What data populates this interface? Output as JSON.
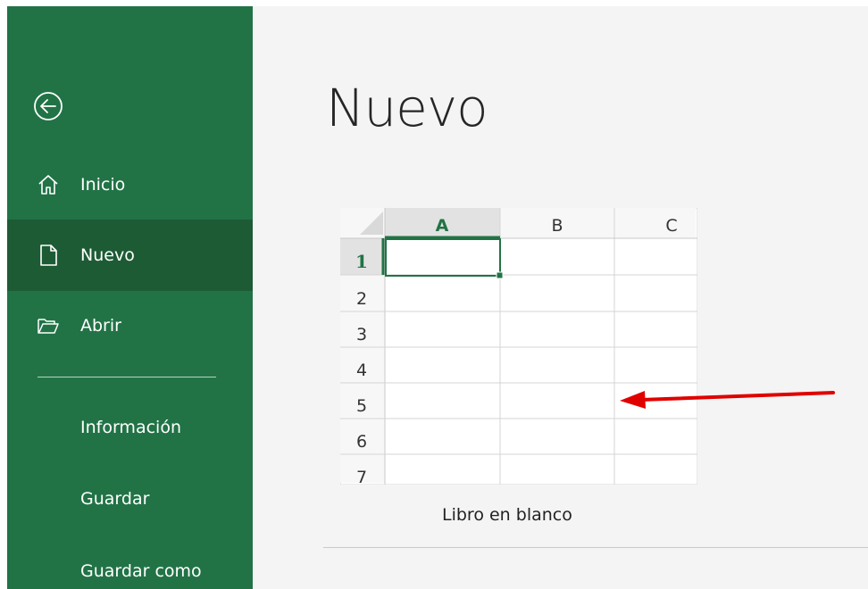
{
  "sidebar": {
    "back_icon": "back-arrow-icon",
    "items": [
      {
        "label": "Inicio",
        "icon": "home-icon"
      },
      {
        "label": "Nuevo",
        "icon": "new-document-icon",
        "selected": true
      },
      {
        "label": "Abrir",
        "icon": "open-folder-icon"
      }
    ],
    "text_items": [
      {
        "label": "Información"
      },
      {
        "label": "Guardar"
      },
      {
        "label": "Guardar como"
      }
    ]
  },
  "main": {
    "title": "Nuevo",
    "template": {
      "label": "Libro en blanco",
      "columns": [
        "A",
        "B",
        "C"
      ],
      "rows": [
        "1",
        "2",
        "3",
        "4",
        "5",
        "6",
        "7"
      ],
      "selected_cell": "A1"
    }
  },
  "colors": {
    "sidebar_bg": "#217346",
    "sidebar_selected_bg": "#1d5b35",
    "main_bg": "#f4f4f4",
    "accent_green": "#217346",
    "annotation_arrow": "#e00000"
  }
}
